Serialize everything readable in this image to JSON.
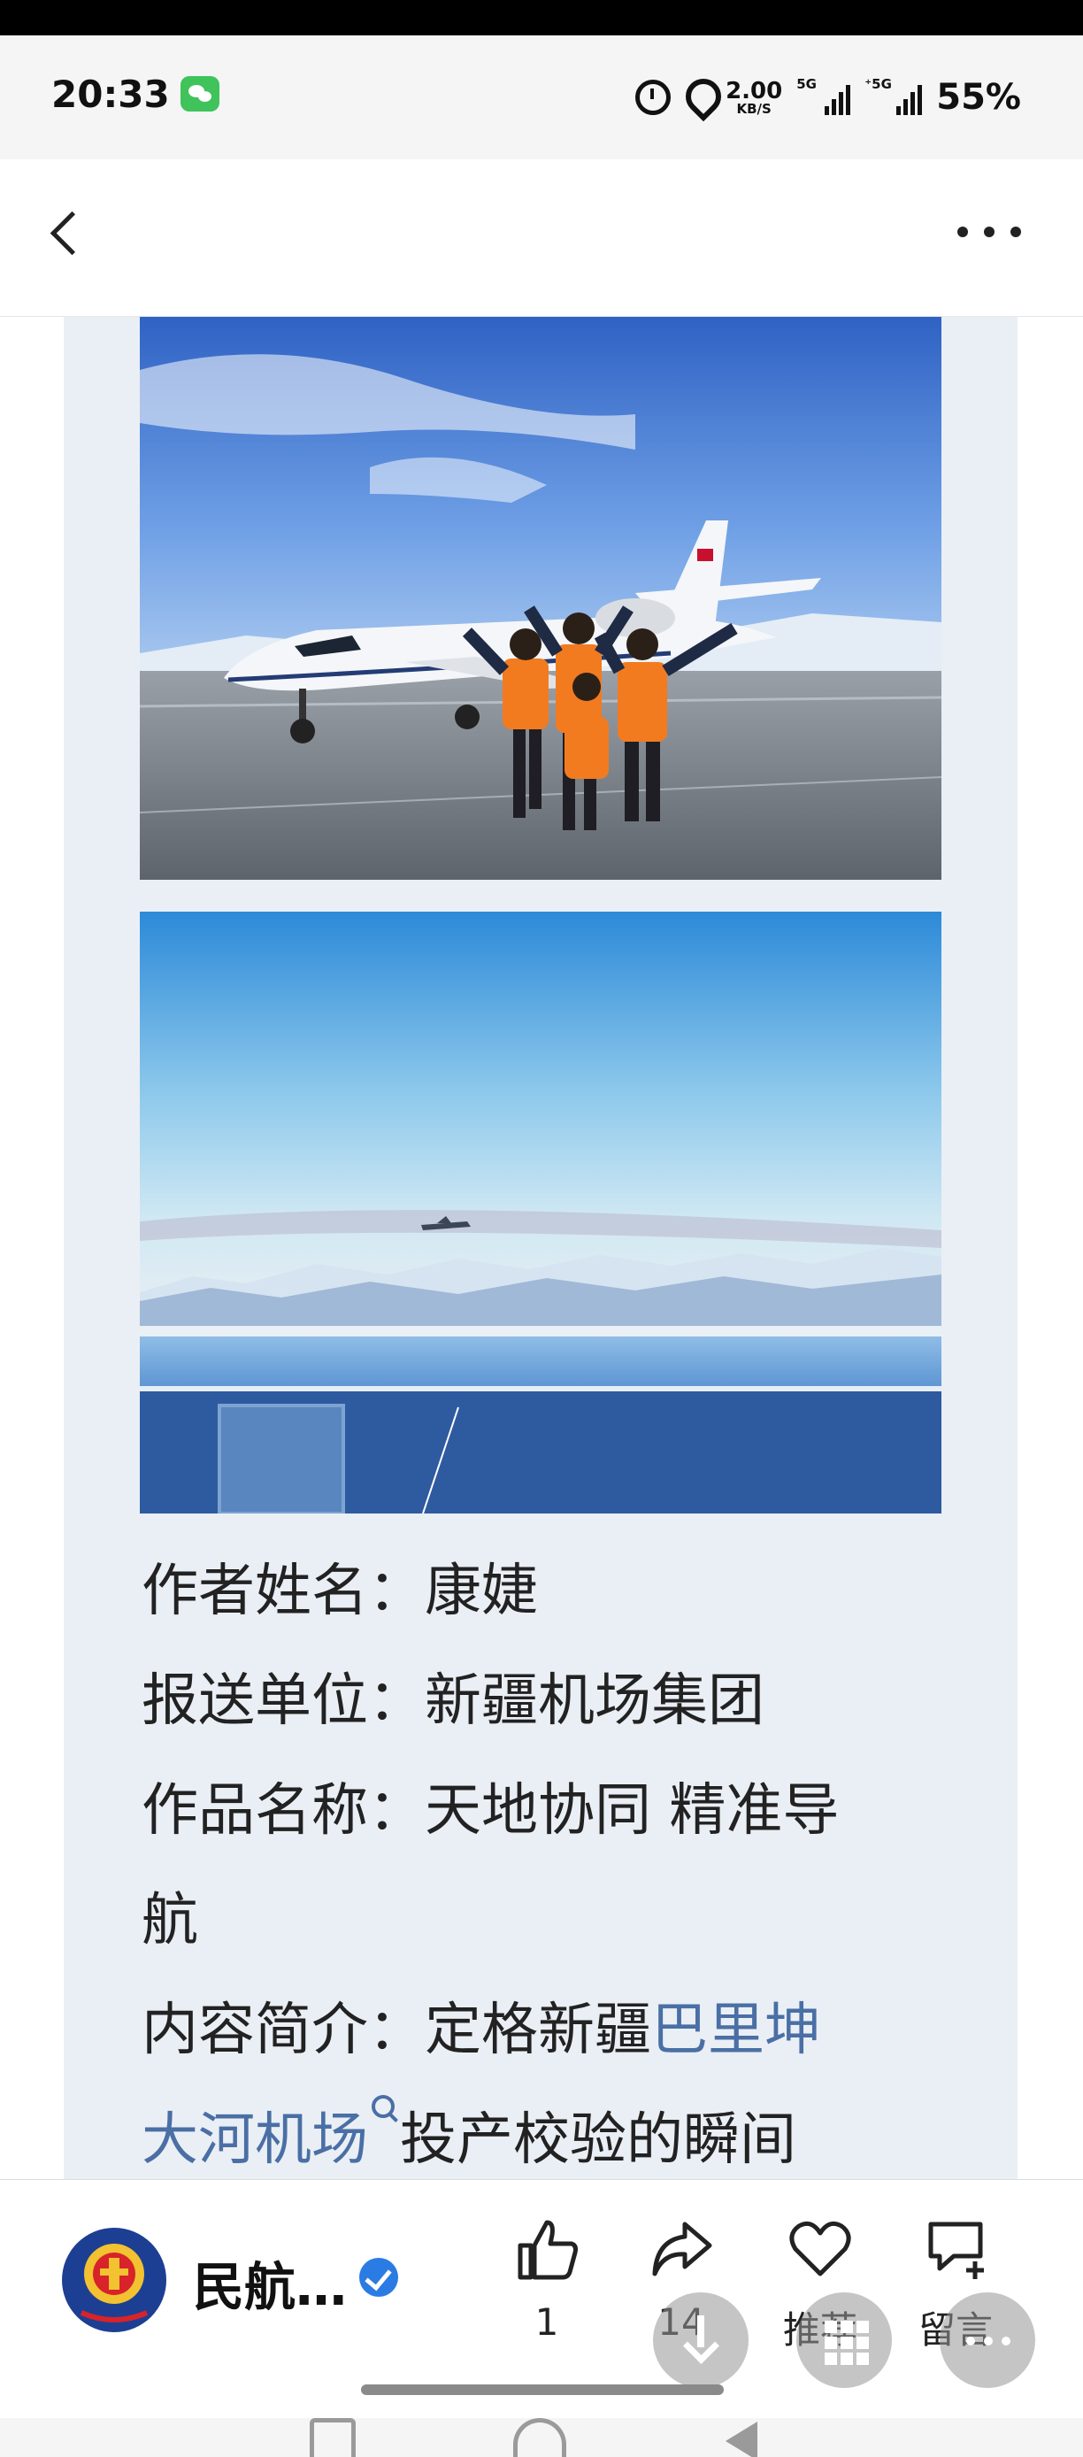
{
  "status_bar": {
    "time": "20:33",
    "network_speed": "2.00",
    "network_speed_unit": "KB/S",
    "signal_tag_1": "5G",
    "signal_tag_2": "⁺5G",
    "battery": "55%"
  },
  "nav": {
    "back_icon": "chevron-left-icon",
    "more_icon": "more-horizontal-icon"
  },
  "article": {
    "photos": [
      {
        "icon": "photo-aircraft-crew"
      },
      {
        "icon": "photo-aircraft-snow-mountains"
      }
    ],
    "lines": {
      "author_label": "作者姓名：",
      "author_value": "康婕",
      "unit_label": "报送单位：",
      "unit_value": "新疆机场集团",
      "work_label": "作品名称：",
      "work_value_1": "天地协同 精准导",
      "work_value_2": "航",
      "intro_label": "内容简介：",
      "intro_value_1": "定格新疆",
      "intro_link_1": "巴里坤",
      "intro_link_2": "大河机场",
      "intro_value_2": "投产校验的瞬间"
    }
  },
  "bottom_bar": {
    "publisher_name": "民航…",
    "like_count": "1",
    "share_count": "14",
    "recommend_label": "推荐",
    "comment_label": "留言"
  },
  "colors": {
    "link": "#4a6fa5",
    "card_bg": "#eaeff5",
    "verified": "#2b7be4"
  }
}
